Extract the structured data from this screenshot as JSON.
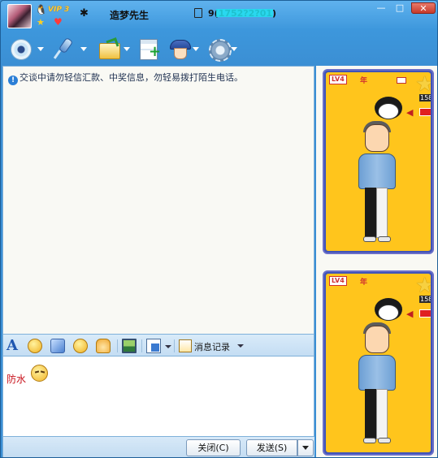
{
  "title_bar": {
    "vip_label": "VIP 3",
    "status_glyph": "✱",
    "nickname": "造梦先生",
    "qq_number_prefix": "9(",
    "qq_number_masked": "1752?2?01)",
    "icons": [
      "qq-penguin-icon",
      "star-icon",
      "heart-icon",
      "mobile-icon"
    ],
    "window_buttons": {
      "minimize": "—",
      "maximize": "□",
      "close": "✕"
    }
  },
  "toolbar": {
    "buttons": [
      {
        "name": "video-call",
        "icon": "camera-icon"
      },
      {
        "name": "voice-call",
        "icon": "microphone-icon"
      },
      {
        "name": "send-file",
        "icon": "folder-icon"
      },
      {
        "name": "create-discussion",
        "icon": "note-add-icon"
      },
      {
        "name": "report",
        "icon": "police-icon"
      },
      {
        "name": "app-settings",
        "icon": "gear-icon"
      }
    ]
  },
  "chat": {
    "notice_icon": "!",
    "notice": "交谈中请勿轻信汇款、中奖信息，勿轻易拨打陌生电话。"
  },
  "input_toolbar": {
    "font_label": "A",
    "history_label": "消息记录",
    "icons": [
      "font-icon",
      "smiley-icon",
      "magic-emoji-icon",
      "fun-icon",
      "shake-icon",
      "image-icon",
      "screenshot-icon",
      "history-icon"
    ]
  },
  "input": {
    "text": "防水",
    "text_color": "#c8101a",
    "emoji": "embarrassed-emoji-icon"
  },
  "buttons": {
    "close_label": "关闭(C)",
    "send_label": "发送(S)"
  },
  "show_cards": [
    {
      "level": "LV4",
      "year_label": "年",
      "count": "158"
    },
    {
      "level": "LV4",
      "year_label": "年",
      "count": "158"
    }
  ],
  "colors": {
    "title_blue": "#3d97dc",
    "card_yellow": "#ffc51c",
    "card_border": "#3f53b8"
  }
}
